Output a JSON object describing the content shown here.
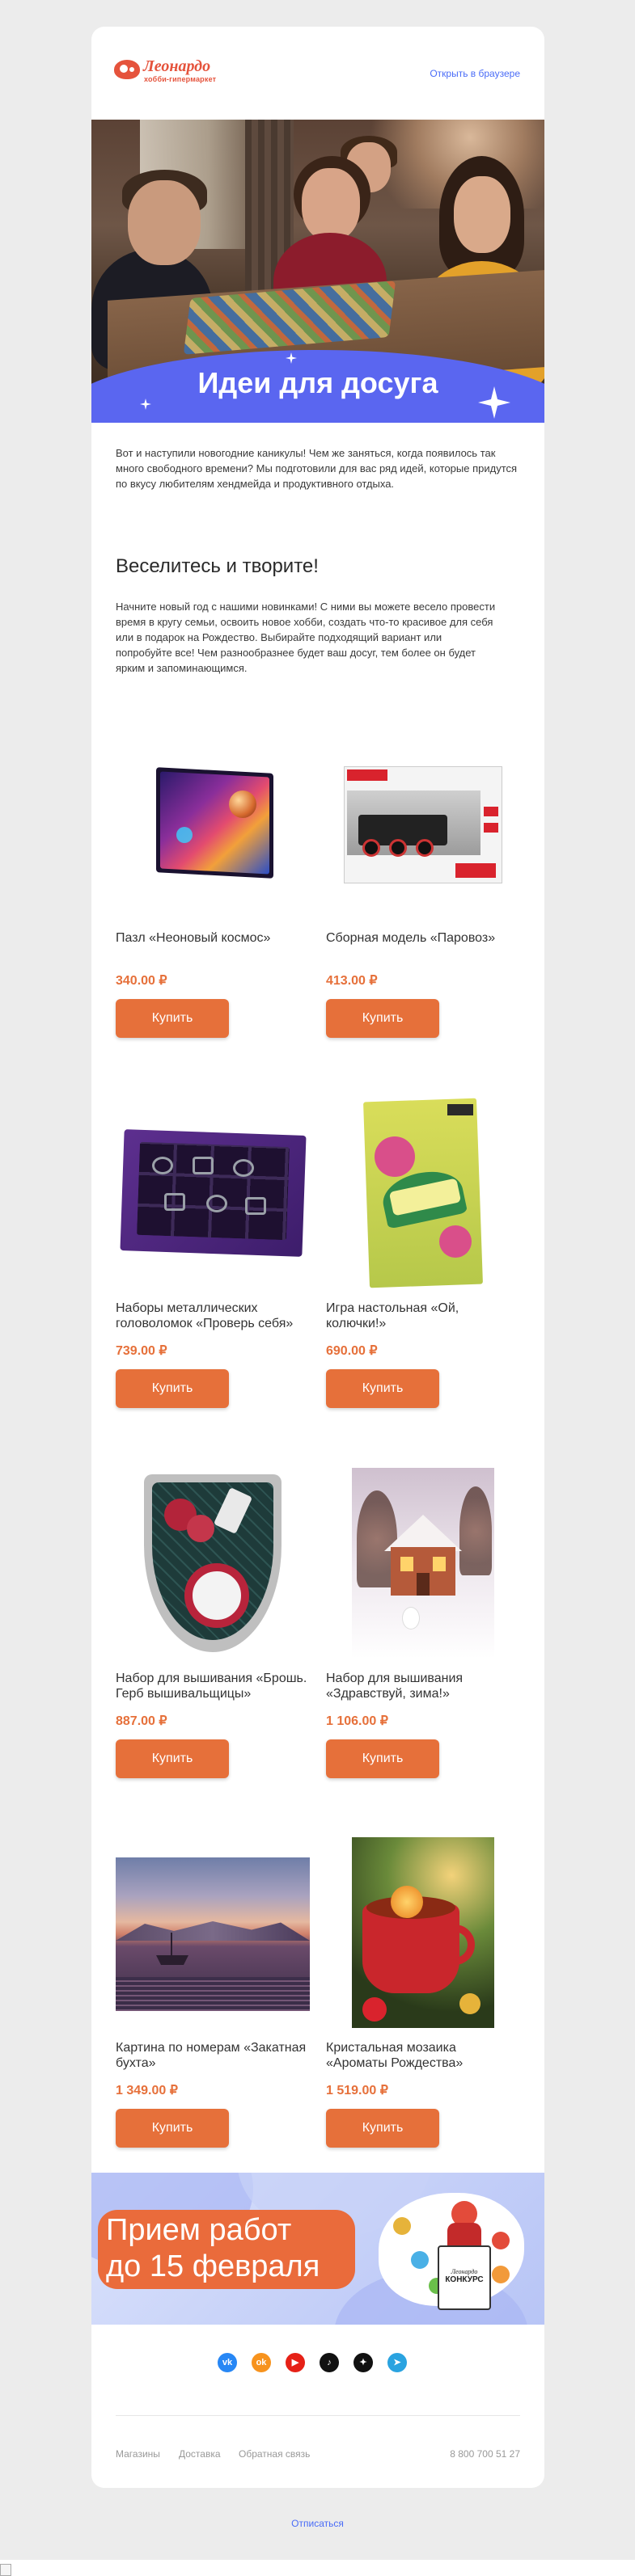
{
  "header": {
    "logo_name": "Леонардо",
    "logo_tagline": "хобби-гипермаркет",
    "browser_link": "Открыть в браузере"
  },
  "hero": {
    "title": "Идеи для досуга"
  },
  "intro": {
    "text": "Вот и наступили новогодние каникулы! Чем же заняться, когда появилось так много свободного времени? Мы подготовили для вас ряд идей, которые придутся по вкусу любителям хендмейда и продуктивного отдыха."
  },
  "section": {
    "title": "Веселитесь и творите!",
    "text": "Начните новый год с нашими новинками! С ними вы можете весело провести время в кругу семьи, освоить новое хобби, создать что-то красивое для себя или в подарок на Рождество. Выбирайте подходящий вариант или попробуйте все! Чем разнообразнее будет ваш досуг, тем более он будет ярким и запоминающимся."
  },
  "products": [
    {
      "name": "Пазл «Неоновый космос»",
      "price": "340.00 ₽",
      "button": "Купить",
      "art": "puzzle-box"
    },
    {
      "name": "Сборная модель «Паровоз»",
      "price": "413.00 ₽",
      "button": "Купить",
      "art": "model-box"
    },
    {
      "name": "Наборы металлических головоломок «Проверь себя»",
      "price": "739.00 ₽",
      "button": "Купить",
      "art": "puzzles-box"
    },
    {
      "name": "Игра настольная «Ой, колючки!»",
      "price": "690.00 ₽",
      "button": "Купить",
      "art": "game-box"
    },
    {
      "name": "Набор для вышивания «Брошь. Герб вышивальщицы»",
      "price": "887.00 ₽",
      "button": "Купить",
      "art": "brooch"
    },
    {
      "name": "Набор для вышивания «Здравствуй, зима!»",
      "price": "1 106.00 ₽",
      "button": "Купить",
      "art": "winter-house"
    },
    {
      "name": "Картина по номерам «Закатная бухта»",
      "price": "1 349.00 ₽",
      "button": "Купить",
      "art": "sunset-bay"
    },
    {
      "name": "Кристальная мозаика «Ароматы Рождества»",
      "price": "1 519.00 ₽",
      "button": "Купить",
      "art": "christmas-mug"
    }
  ],
  "banner": {
    "line1": "Прием работ",
    "line2": "до 15 февраля",
    "contest_brand": "Леонардо",
    "contest_title": "КОНКУРС"
  },
  "social": [
    {
      "icon": "vk-icon",
      "glyph": "vk",
      "color": "#2787f5"
    },
    {
      "icon": "odnoklassniki-icon",
      "glyph": "ok",
      "color": "#f7931e"
    },
    {
      "icon": "youtube-icon",
      "glyph": "▶",
      "color": "#e62117"
    },
    {
      "icon": "tiktok-icon",
      "glyph": "♪",
      "color": "#111111"
    },
    {
      "icon": "dzen-icon",
      "glyph": "✦",
      "color": "#111111"
    },
    {
      "icon": "telegram-icon",
      "glyph": "➤",
      "color": "#2aa3e0"
    }
  ],
  "footer": {
    "stores": "Магазины",
    "delivery": "Доставка",
    "feedback": "Обратная связь",
    "phone": "8 800 700 51 27",
    "unsubscribe": "Отписаться"
  },
  "colors": {
    "accent": "#e6703a",
    "link": "#4a6cf7",
    "hero_band": "#5a66f0"
  }
}
